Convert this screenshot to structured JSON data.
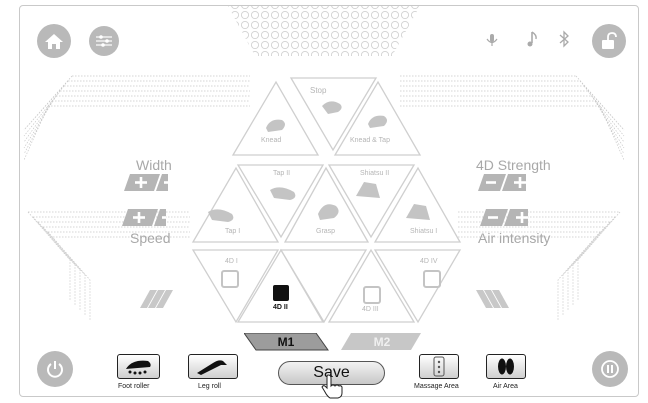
{
  "modes": {
    "stop": "Stop",
    "knead": "Knead",
    "knead_tap": "Knead & Tap",
    "tap2": "Tap II",
    "shiatsu2": "Shiatsu II",
    "tap1": "Tap I",
    "grasp": "Grasp",
    "shiatsu1": "Shiatsu I",
    "d4_1": "4D I",
    "d4_2": "4D II",
    "d4_3": "4D III",
    "d4_4": "4D IV"
  },
  "controls": {
    "width": "Width",
    "speed": "Speed",
    "strength": "4D Strength",
    "air_intensity": "Air intensity"
  },
  "memory": {
    "m1": "M1",
    "m2": "M2"
  },
  "save_label": "Save",
  "bottom_bar": {
    "foot_roller": "Foot roller",
    "leg_roll": "Leg roll",
    "massage_area": "Massage Area",
    "air_area": "Air Area"
  },
  "colors": {
    "button_gray": "#b9b9b9",
    "label_gray": "#a8a8a8",
    "active": "#111111"
  }
}
